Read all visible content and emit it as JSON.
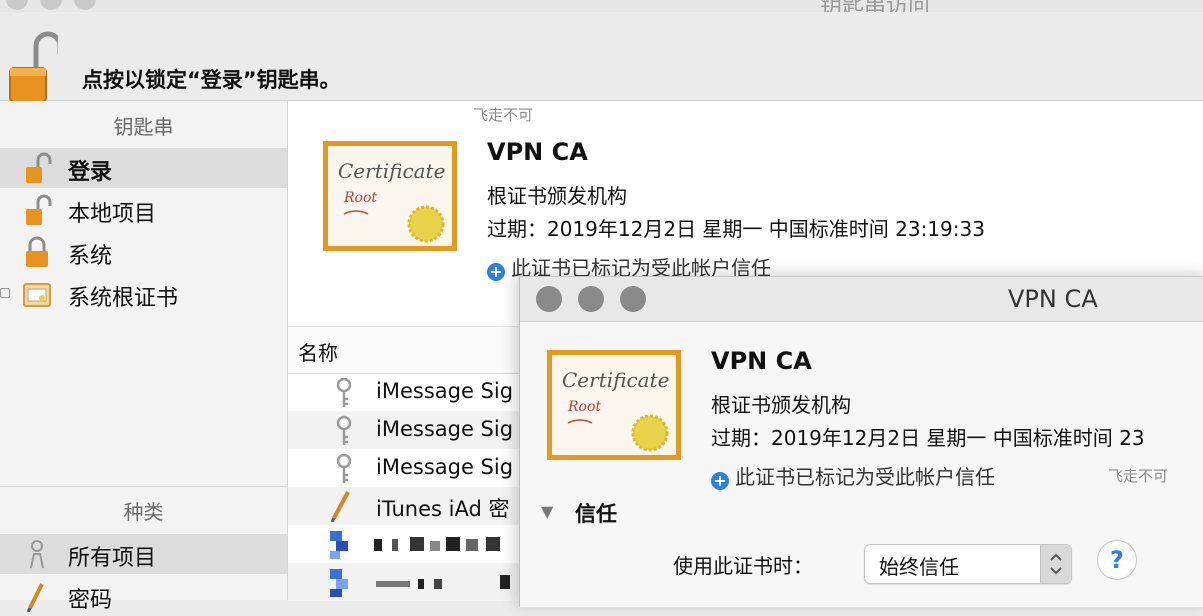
{
  "window": {
    "title": "钥匙串访问",
    "lock_message": "点按以锁定“登录”钥匙串。"
  },
  "sidebar": {
    "keychains_header": "钥匙串",
    "keychains": [
      {
        "label": "登录",
        "icon": "unlocked-padlock-icon",
        "selected": true
      },
      {
        "label": "本地项目",
        "icon": "unlocked-padlock-icon",
        "selected": false
      },
      {
        "label": "系统",
        "icon": "locked-padlock-icon",
        "selected": false
      },
      {
        "label": "系统根证书",
        "icon": "certificate-folder-icon",
        "selected": false
      }
    ],
    "categories_header": "种类",
    "categories": [
      {
        "label": "所有项目",
        "icon": "people-icon",
        "selected": true
      },
      {
        "label": "密码",
        "icon": "pencil-icon",
        "selected": false
      }
    ]
  },
  "summary": {
    "name": "VPN CA",
    "kind": "根证书颁发机构",
    "expiry": "过期：2019年12月2日 星期一 中国标准时间 23:19:33",
    "trust_note": "此证书已标记为受此帐户信任"
  },
  "list": {
    "name_header": "名称",
    "rows": [
      {
        "label": "iMessage Sig",
        "icon": "key-icon"
      },
      {
        "label": "iMessage Sig",
        "icon": "key-icon"
      },
      {
        "label": "iMessage Sig",
        "icon": "key-icon"
      },
      {
        "label": "iTunes iAd 密",
        "icon": "pencil-icon"
      }
    ]
  },
  "watermark": "飞走不可",
  "detail": {
    "title": "VPN CA",
    "name": "VPN CA",
    "kind": "根证书颁发机构",
    "expiry": "过期：2019年12月2日 星期一 中国标准时间 23",
    "trust_note": "此证书已标记为受此帐户信任",
    "trust_section": "信任",
    "use_label": "使用此证书时：",
    "trust_value": "始终信任",
    "help": "?"
  },
  "cert_badge": {
    "line1": "Certificate",
    "line2": "Root"
  },
  "colors": {
    "accent": "#2f7fe0",
    "cert_frame": "#e39a1e",
    "seal": "#e8d24a"
  }
}
